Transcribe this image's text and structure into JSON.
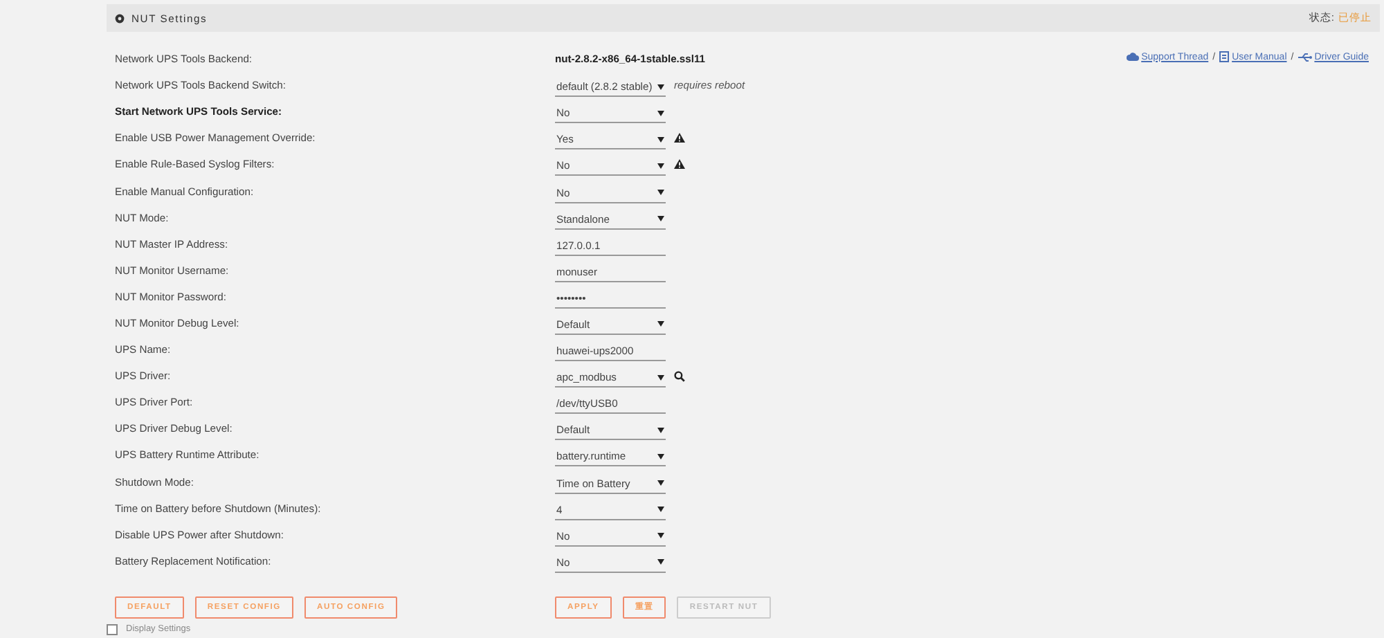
{
  "panel": {
    "title": "NUT Settings",
    "status_label": "状态:",
    "status_value": "已停止"
  },
  "links": [
    {
      "label": "Support Thread"
    },
    {
      "separator": "/",
      "label": "User Manual"
    },
    {
      "separator": "/",
      "label": "Driver Guide"
    }
  ],
  "settings": [
    {
      "label": "Network UPS Tools Backend:",
      "kind": "text",
      "value": "nut-2.8.2-x86_64-1stable.ssl11"
    },
    {
      "label": "Network UPS Tools Backend Switch:",
      "kind": "select",
      "value": "default (2.8.2 stable)",
      "note": "requires reboot"
    },
    {
      "label": "Start Network UPS Tools Service:",
      "kind": "select",
      "value": "No",
      "emphasis": true
    },
    {
      "label": "Enable USB Power Management Override:",
      "kind": "select",
      "value": "Yes",
      "warning": true
    },
    {
      "label": "Enable Rule-Based Syslog Filters:",
      "kind": "select",
      "value": "No",
      "warning": true
    },
    {
      "label": "Enable Manual Configuration:",
      "kind": "select",
      "value": "No"
    },
    {
      "label": "NUT Mode:",
      "kind": "select",
      "value": "Standalone"
    },
    {
      "label": "NUT Master IP Address:",
      "kind": "input",
      "value": "127.0.0.1"
    },
    {
      "label": "NUT Monitor Username:",
      "kind": "input",
      "value": "monuser"
    },
    {
      "label": "NUT Monitor Password:",
      "kind": "input",
      "value": "••••••••"
    },
    {
      "label": "NUT Monitor Debug Level:",
      "kind": "select",
      "value": "Default"
    },
    {
      "label": "UPS Name:",
      "kind": "input",
      "value": "huawei-ups2000"
    },
    {
      "label": "UPS Driver:",
      "kind": "select",
      "value": "apc_modbus",
      "search": true
    },
    {
      "label": "UPS Driver Port:",
      "kind": "input",
      "value": "/dev/ttyUSB0"
    },
    {
      "label": "UPS Driver Debug Level:",
      "kind": "select",
      "value": "Default"
    },
    {
      "label": "UPS Battery Runtime Attribute:",
      "kind": "select",
      "value": "battery.runtime"
    },
    {
      "label": "Shutdown Mode:",
      "kind": "select",
      "value": "Time on Battery"
    },
    {
      "label": "Time on Battery before Shutdown (Minutes):",
      "kind": "select",
      "value": "4"
    },
    {
      "label": "Disable UPS Power after Shutdown:",
      "kind": "select",
      "value": "No"
    },
    {
      "label": "Battery Replacement Notification:",
      "kind": "select",
      "value": "No"
    }
  ],
  "left_buttons": [
    {
      "label": "DEFAULT",
      "disabled": false
    },
    {
      "label": "RESET CONFIG",
      "disabled": false
    },
    {
      "label": "AUTO CONFIG",
      "disabled": false
    }
  ],
  "right_buttons": [
    {
      "label": "APPLY",
      "disabled": false
    },
    {
      "label": "重置",
      "disabled": false
    },
    {
      "label": "RESTART NUT",
      "disabled": true
    }
  ],
  "display_settings": {
    "label": "Display Settings",
    "checked": false
  }
}
